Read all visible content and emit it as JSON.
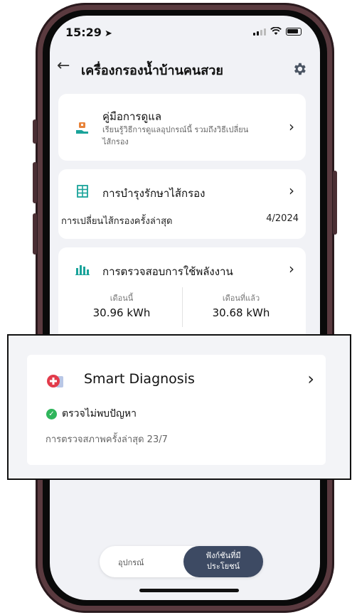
{
  "status_bar": {
    "time": "15:29"
  },
  "header": {
    "title": "เครื่องกรองน้ำบ้านคนสวย"
  },
  "care_manual": {
    "title": "คู่มือการดูแล",
    "subtitle_line1": "เรียนรู้วิธีการดูแลอุปกรณ์นี้ รวมถึงวิธีเปลี่ยน",
    "subtitle_line2": "ไส้กรอง"
  },
  "filter_maintenance": {
    "title": "การบำรุงรักษาไส้กรอง",
    "last_change_label": "การเปลี่ยนไส้กรองครั้งล่าสุด",
    "last_change_value": "4/2024"
  },
  "energy": {
    "title": "การตรวจสอบการใช้พลังงาน",
    "this_month_label": "เดือนนี้",
    "this_month_value": "30.96 kWh",
    "last_month_label": "เดือนที่แล้ว",
    "last_month_value": "30.68 kWh"
  },
  "smart_diagnosis": {
    "title": "Smart Diagnosis",
    "status": "ตรวจไม่พบปัญหา",
    "last_check": "การตรวจสภาพครั้งล่าสุด 23/7"
  },
  "tabs": {
    "device": "อุปกรณ์",
    "features_line1": "ฟังก์ชันที่มี",
    "features_line2": "ประโยชน์"
  },
  "colors": {
    "frame": "#5a3a3f",
    "accent_green": "#2fb55b",
    "tab_active": "#3d4a63",
    "teal_icon": "#1aa39a",
    "orange_icon": "#e8833a",
    "diag_red": "#e23b4b"
  }
}
